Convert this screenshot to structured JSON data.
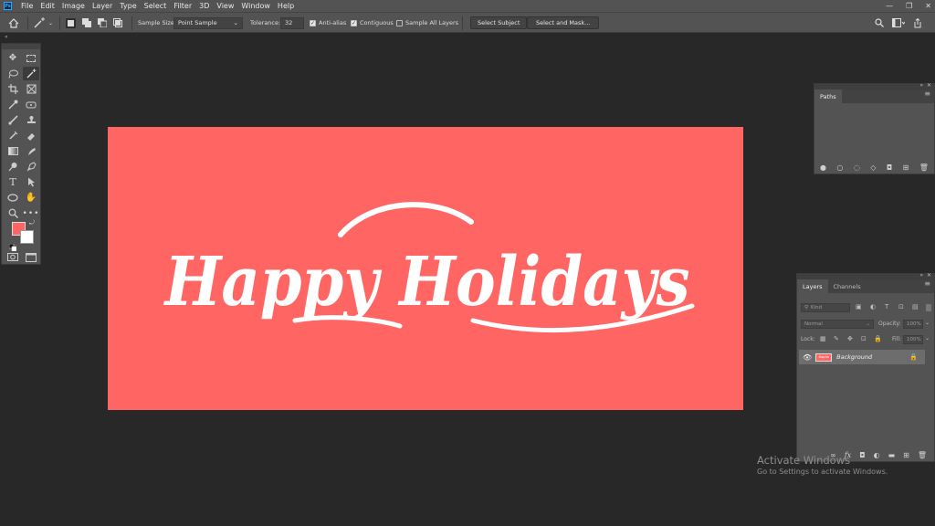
{
  "menu": {
    "app_icon": "Ps",
    "items": [
      "File",
      "Edit",
      "Image",
      "Layer",
      "Type",
      "Select",
      "Filter",
      "3D",
      "View",
      "Window",
      "Help"
    ],
    "window_controls": [
      "—",
      "❐",
      "✕"
    ]
  },
  "options": {
    "sample_size_label": "Sample Size:",
    "sample_size_value": "Point Sample",
    "tolerance_label": "Tolerance:",
    "tolerance_value": "32",
    "anti_alias_label": "Anti-alias",
    "anti_alias_checked": true,
    "contiguous_label": "Contiguous",
    "contiguous_checked": true,
    "sample_all_layers_label": "Sample All Layers",
    "sample_all_layers_checked": false,
    "select_subject_label": "Select Subject",
    "select_and_mask_label": "Select and Mask..."
  },
  "toolbox": {
    "tools": [
      "move-tool",
      "marquee-tool",
      "lasso-tool",
      "magic-wand-tool",
      "crop-tool",
      "frame-tool",
      "eyedropper-tool",
      "healing-tool",
      "brush-tool",
      "stamp-tool",
      "history-brush-tool",
      "eraser-tool",
      "gradient-tool",
      "smudge-tool",
      "dodge-tool",
      "pen-tool",
      "type-tool",
      "path-selection-tool",
      "ellipse-tool",
      "hand-tool",
      "zoom-tool",
      "more-tools"
    ],
    "active_tool": "magic-wand-tool",
    "foreground_color": "#ff6663",
    "background_color": "#ffffff"
  },
  "canvas": {
    "text": "Happy Holidays",
    "background_color": "#ff6663",
    "text_color": "#ffffff"
  },
  "paths_panel": {
    "tab": "Paths"
  },
  "layers_panel": {
    "tabs": [
      "Layers",
      "Channels"
    ],
    "active_tab": "Layers",
    "filter_placeholder": "Kind",
    "blend_mode": "Normal",
    "opacity_label": "Opacity:",
    "opacity_value": "100%",
    "lock_label": "Lock:",
    "fill_label": "Fill:",
    "fill_value": "100%",
    "layers": [
      {
        "name": "Background",
        "visible": true,
        "locked": true,
        "thumbnail_text": "Bapha"
      }
    ],
    "footer_icons": [
      "link-icon",
      "fx-icon",
      "mask-icon",
      "adjustment-icon",
      "folder-icon",
      "new-layer-icon",
      "trash-icon"
    ]
  },
  "watermark": {
    "title": "Activate Windows",
    "subtitle": "Go to Settings to activate Windows."
  }
}
